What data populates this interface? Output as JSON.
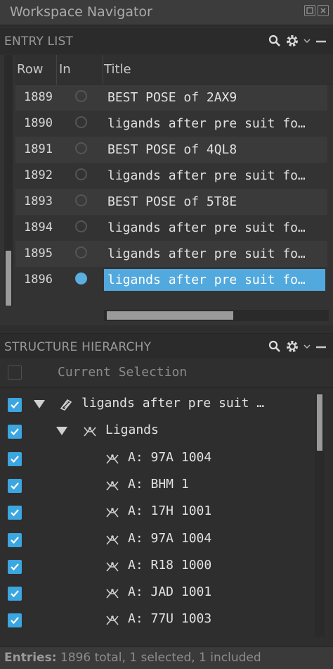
{
  "window": {
    "title": "Workspace Navigator"
  },
  "entry_list": {
    "header": "ENTRY LIST",
    "columns": [
      "Row",
      "In",
      "Title"
    ],
    "rows": [
      {
        "row": "1889",
        "included": false,
        "title": "BEST POSE of 2AX9",
        "selected": false
      },
      {
        "row": "1890",
        "included": false,
        "title": "ligands after pre suit fo…",
        "selected": false
      },
      {
        "row": "1891",
        "included": false,
        "title": "BEST POSE of 4QL8",
        "selected": false
      },
      {
        "row": "1892",
        "included": false,
        "title": "ligands after pre suit fo…",
        "selected": false
      },
      {
        "row": "1893",
        "included": false,
        "title": "BEST POSE of 5T8E",
        "selected": false
      },
      {
        "row": "1894",
        "included": false,
        "title": "ligands after pre suit fo…",
        "selected": false
      },
      {
        "row": "1895",
        "included": false,
        "title": "ligands after pre suit fo…",
        "selected": false
      },
      {
        "row": "1896",
        "included": true,
        "title": "ligands after pre suit fo…",
        "selected": true
      }
    ]
  },
  "structure_hierarchy": {
    "header": "STRUCTURE HIERARCHY",
    "current_selection": "Current Selection",
    "nodes": [
      {
        "label": "ligands after pre suit …",
        "checked": true,
        "expanded": true,
        "icon": "entry-icon",
        "level": 0
      },
      {
        "label": "Ligands",
        "checked": true,
        "expanded": true,
        "icon": "ligand-icon",
        "level": 1
      },
      {
        "label": "A: 97A 1004",
        "checked": true,
        "icon": "ligand-icon",
        "level": 2
      },
      {
        "label": "A: BHM 1",
        "checked": true,
        "icon": "ligand-icon",
        "level": 2
      },
      {
        "label": "A: 17H 1001",
        "checked": true,
        "icon": "ligand-icon",
        "level": 2
      },
      {
        "label": "A: 97A 1004",
        "checked": true,
        "icon": "ligand-icon",
        "level": 2
      },
      {
        "label": "A: R18 1000",
        "checked": true,
        "icon": "ligand-icon",
        "level": 2
      },
      {
        "label": "A: JAD 1001",
        "checked": true,
        "icon": "ligand-icon",
        "level": 2
      },
      {
        "label": "A: 77U 1003",
        "checked": true,
        "icon": "ligand-icon",
        "level": 2
      }
    ]
  },
  "status": {
    "label": "Entries:",
    "text": "1896 total, 1 selected, 1 included"
  },
  "colors": {
    "selection": "#52a9de",
    "checkbox": "#3ba6e0",
    "background": "#2e2e2e"
  }
}
